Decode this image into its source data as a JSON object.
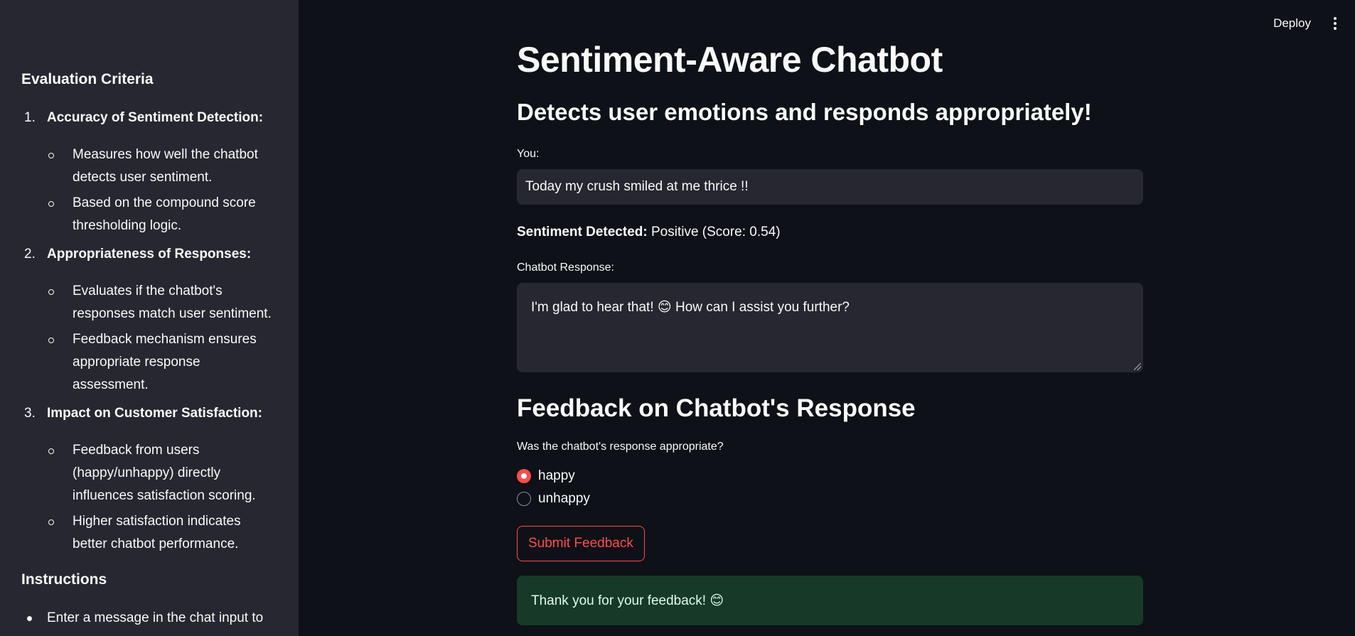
{
  "sidebar": {
    "evaluation_heading": "Evaluation Criteria",
    "criteria": [
      {
        "number": "1.",
        "title": "Accuracy of Sentiment Detection:",
        "points": [
          "Measures how well the chatbot detects user sentiment.",
          "Based on the compound score thresholding logic."
        ]
      },
      {
        "number": "2.",
        "title": "Appropriateness of Responses:",
        "points": [
          "Evaluates if the chatbot's responses match user sentiment.",
          "Feedback mechanism ensures appropriate response assessment."
        ]
      },
      {
        "number": "3.",
        "title": "Impact on Customer Satisfaction:",
        "points": [
          "Feedback from users (happy/unhappy) directly influences satisfaction scoring.",
          "Higher satisfaction indicates better chatbot performance."
        ]
      }
    ],
    "instructions_heading": "Instructions",
    "instructions": [
      "Enter a message in the chat input to"
    ]
  },
  "toolbar": {
    "deploy_label": "Deploy",
    "menu_icon": "kebab-menu-icon"
  },
  "main": {
    "title": "Sentiment-Aware Chatbot",
    "subtitle": "Detects user emotions and responds appropriately!",
    "input_label": "You:",
    "input_value": "Today my crush smiled at me thrice !!",
    "sentiment_label": "Sentiment Detected:",
    "sentiment_value": " Positive (Score: 0.54)",
    "response_label": "Chatbot Response:",
    "response_value": "I'm glad to hear that! 😊 How can I assist you further?",
    "feedback_heading": "Feedback on Chatbot's Response",
    "feedback_question": "Was the chatbot's response appropriate?",
    "options": [
      "happy",
      "unhappy"
    ],
    "selected_option": "happy",
    "submit_label": "Submit Feedback",
    "success_message": "Thank you for your feedback! 😊"
  },
  "colors": {
    "accent": "#ff4b4b",
    "background": "#0e1117",
    "sidebar": "#262730",
    "success_bg": "#173928"
  }
}
